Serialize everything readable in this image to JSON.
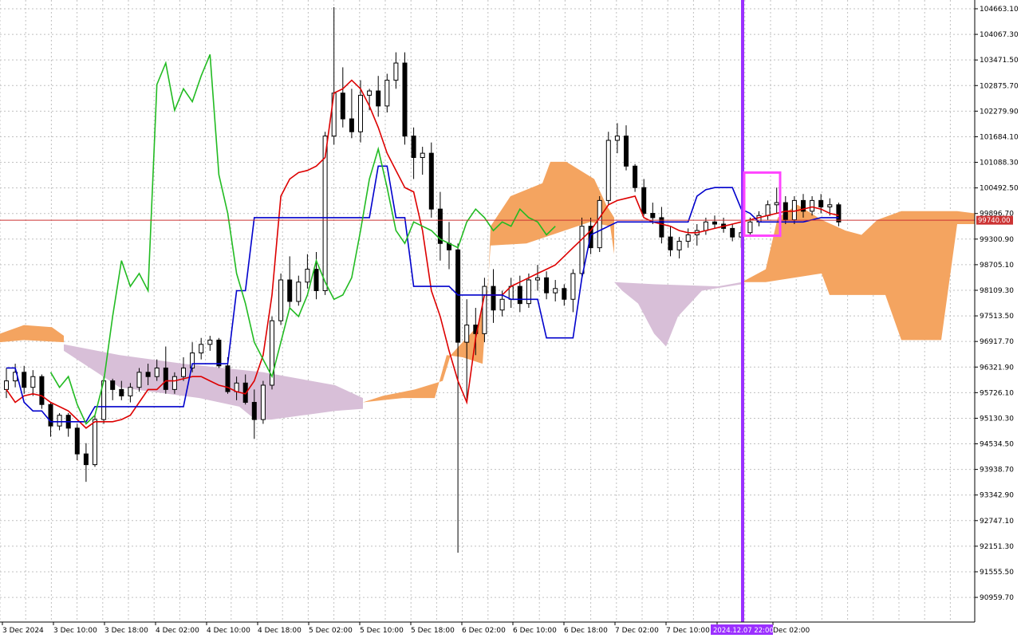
{
  "chart_data": {
    "type": "candlestick",
    "title": "",
    "xlabel": "",
    "ylabel": "",
    "ylim": [
      90600,
      104900
    ],
    "grid": true,
    "y_ticks": [
      104663.1,
      104067.3,
      103471.5,
      102875.7,
      102279.9,
      101684.1,
      101088.3,
      100492.5,
      99896.7,
      99300.9,
      98705.1,
      98109.3,
      97513.5,
      96917.7,
      96321.9,
      95726.1,
      95130.3,
      94534.5,
      93938.7,
      93342.9,
      92747.1,
      92151.3,
      91555.5,
      90959.7
    ],
    "x_ticks": [
      "3 Dec 2024",
      "3 Dec 10:00",
      "3 Dec 18:00",
      "4 Dec 02:00",
      "4 Dec 10:00",
      "4 Dec 18:00",
      "5 Dec 02:00",
      "5 Dec 10:00",
      "5 Dec 18:00",
      "6 Dec 02:00",
      "6 Dec 10:00",
      "6 Dec 18:00",
      "7 Dec 02:00",
      "7 Dec 10:00",
      "",
      "Dec 02:00"
    ],
    "current_price": 99740.0,
    "current_price_label": "99740.00",
    "cursor_label": "2024.12.07 22:00",
    "cursor_x": 2024.1207,
    "colors": {
      "tenkan": "#dd0000",
      "kijun": "#0000cc",
      "chikou": "#22bb22",
      "kumo_bull": "#f4a460",
      "kumo_bear": "#d8bfd8",
      "cursor": "#9b30ff",
      "highlight": "#ff44ff",
      "price_line": "#cc3333",
      "grid": "#c0c0c0"
    },
    "candles": [
      [
        95800,
        96300,
        95600,
        96000
      ],
      [
        96000,
        96400,
        95850,
        96200
      ],
      [
        96200,
        96350,
        95700,
        95850
      ],
      [
        95850,
        96250,
        95650,
        96100
      ],
      [
        96100,
        96150,
        95350,
        95450
      ],
      [
        95450,
        95500,
        94700,
        94950
      ],
      [
        94950,
        95250,
        94850,
        95200
      ],
      [
        95200,
        95250,
        94700,
        94900
      ],
      [
        94900,
        95000,
        94150,
        94300
      ],
      [
        94300,
        94550,
        93650,
        94050
      ],
      [
        94050,
        95200,
        94000,
        95100
      ],
      [
        95100,
        96100,
        95000,
        96000
      ],
      [
        96000,
        96050,
        95550,
        95800
      ],
      [
        95800,
        96000,
        95550,
        95650
      ],
      [
        95650,
        95950,
        95500,
        95850
      ],
      [
        95850,
        96300,
        95750,
        96200
      ],
      [
        96200,
        96400,
        95900,
        96100
      ],
      [
        96100,
        96500,
        96000,
        96300
      ],
      [
        96300,
        96800,
        95700,
        95800
      ],
      [
        95800,
        96200,
        95700,
        96100
      ],
      [
        96100,
        96550,
        96000,
        96300
      ],
      [
        96300,
        96900,
        96200,
        96650
      ],
      [
        96650,
        97000,
        96500,
        96850
      ],
      [
        96850,
        97050,
        96700,
        96950
      ],
      [
        96950,
        97000,
        96300,
        96350
      ],
      [
        96350,
        96550,
        95700,
        95750
      ],
      [
        95750,
        96100,
        95550,
        95950
      ],
      [
        95950,
        96150,
        95450,
        95500
      ],
      [
        95500,
        95800,
        94650,
        95100
      ],
      [
        95100,
        96000,
        95000,
        95900
      ],
      [
        95900,
        97500,
        95800,
        97400
      ],
      [
        97400,
        98500,
        97300,
        98350
      ],
      [
        98350,
        98900,
        97700,
        97850
      ],
      [
        97850,
        98450,
        97750,
        98300
      ],
      [
        98300,
        98950,
        98150,
        98600
      ],
      [
        98600,
        99000,
        97900,
        98100
      ],
      [
        98100,
        101800,
        98000,
        101700
      ],
      [
        101700,
        104700,
        101500,
        102700
      ],
      [
        102700,
        103300,
        101900,
        102100
      ],
      [
        102100,
        102800,
        101650,
        101800
      ],
      [
        101800,
        103000,
        101550,
        102650
      ],
      [
        102650,
        102800,
        102300,
        102750
      ],
      [
        102750,
        103100,
        102150,
        102400
      ],
      [
        102400,
        103150,
        102250,
        103000
      ],
      [
        103000,
        103650,
        102800,
        103400
      ],
      [
        103400,
        103650,
        101500,
        101700
      ],
      [
        101700,
        101900,
        100700,
        101200
      ],
      [
        101200,
        101450,
        100800,
        101300
      ],
      [
        101300,
        101550,
        99800,
        100000
      ],
      [
        100000,
        100400,
        98800,
        99200
      ],
      [
        99200,
        99700,
        98600,
        99050
      ],
      [
        99050,
        99200,
        92000,
        96900
      ],
      [
        96900,
        97900,
        95500,
        97300
      ],
      [
        97300,
        97700,
        96600,
        97100
      ],
      [
        97100,
        98400,
        96900,
        98200
      ],
      [
        98200,
        98600,
        97350,
        97650
      ],
      [
        97650,
        98100,
        97500,
        97900
      ],
      [
        97900,
        98400,
        97700,
        98200
      ],
      [
        98200,
        98450,
        97600,
        97800
      ],
      [
        97800,
        98500,
        97700,
        98350
      ],
      [
        98350,
        98700,
        98100,
        98400
      ],
      [
        98400,
        98550,
        97900,
        98050
      ],
      [
        98050,
        98350,
        97850,
        98150
      ],
      [
        98150,
        98250,
        97750,
        97900
      ],
      [
        97900,
        98600,
        97600,
        98500
      ],
      [
        98500,
        99800,
        98400,
        99600
      ],
      [
        99600,
        99800,
        98950,
        99100
      ],
      [
        99100,
        100300,
        99000,
        100200
      ],
      [
        100200,
        101800,
        100100,
        101600
      ],
      [
        101600,
        102000,
        101300,
        101700
      ],
      [
        101700,
        101950,
        100900,
        101000
      ],
      [
        101000,
        101050,
        100400,
        100500
      ],
      [
        100500,
        100700,
        99850,
        99900
      ],
      [
        99900,
        100150,
        99650,
        99800
      ],
      [
        99800,
        100050,
        99200,
        99350
      ],
      [
        99350,
        99600,
        98900,
        99050
      ],
      [
        99050,
        99350,
        98850,
        99250
      ],
      [
        99250,
        99550,
        99100,
        99400
      ],
      [
        99400,
        99650,
        99150,
        99500
      ],
      [
        99500,
        99800,
        99400,
        99700
      ],
      [
        99700,
        99850,
        99550,
        99650
      ],
      [
        99650,
        99800,
        99450,
        99550
      ],
      [
        99550,
        99650,
        99250,
        99350
      ],
      [
        99350,
        99600,
        99100,
        99450
      ],
      [
        99450,
        99800,
        99350,
        99700
      ],
      [
        99700,
        99950,
        99600,
        99850
      ],
      [
        99850,
        100200,
        99750,
        100100
      ],
      [
        100100,
        100500,
        99900,
        100150
      ],
      [
        100150,
        100300,
        99650,
        99750
      ],
      [
        99750,
        100300,
        99650,
        100200
      ],
      [
        100200,
        100350,
        99800,
        99950
      ],
      [
        99950,
        100300,
        99850,
        100200
      ],
      [
        100200,
        100350,
        99900,
        100050
      ],
      [
        100050,
        100250,
        99850,
        100100
      ],
      [
        100100,
        100150,
        99600,
        99700
      ]
    ],
    "series": [
      {
        "name": "",
        "color": "#dd0000",
        "values": [
          95800,
          95500,
          95650,
          95700,
          95650,
          95500,
          95400,
          95300,
          95100,
          94900,
          95050,
          95050,
          95050,
          95100,
          95200,
          95500,
          95800,
          95800,
          96000,
          96000,
          96050,
          96100,
          96100,
          96000,
          95900,
          95850,
          95750,
          95700,
          96000,
          96600,
          98000,
          100300,
          100700,
          100850,
          100900,
          101000,
          101200,
          102700,
          102800,
          103000,
          102800,
          102400,
          101900,
          101300,
          100900,
          100500,
          100400,
          99500,
          98100,
          97500,
          96700,
          96000,
          95500,
          97000,
          98000,
          98000,
          98000,
          98200,
          98300,
          98400,
          98500,
          98600,
          98700,
          98900,
          99100,
          99300,
          99500,
          99800,
          100100,
          100200,
          100250,
          100300,
          99800,
          99700,
          99650,
          99600,
          99500,
          99450,
          99450,
          99500,
          99550,
          99600,
          99650,
          99700,
          99750,
          99800,
          99850,
          99900,
          99950,
          99950,
          100000,
          100050,
          100000,
          99900,
          99850
        ]
      },
      {
        "name": "",
        "color": "#0000cc",
        "values": [
          96300,
          96300,
          95500,
          95300,
          95300,
          95050,
          95050,
          95050,
          95050,
          95050,
          95400,
          95400,
          95400,
          95400,
          95400,
          95400,
          95400,
          95400,
          95400,
          95400,
          95400,
          96400,
          96400,
          96400,
          96400,
          96400,
          98100,
          98100,
          99800,
          99800,
          99800,
          99800,
          99800,
          99800,
          99800,
          99800,
          99800,
          99800,
          99800,
          99800,
          99800,
          99800,
          101000,
          101000,
          99800,
          99800,
          98200,
          98200,
          98200,
          98200,
          98200,
          98000,
          98000,
          98000,
          98000,
          98000,
          98000,
          97900,
          97900,
          97900,
          97900,
          97000,
          97000,
          97000,
          97000,
          98400,
          99400,
          99500,
          99600,
          99700,
          99700,
          99700,
          99700,
          99700,
          99700,
          99700,
          99700,
          99700,
          100300,
          100450,
          100500,
          100500,
          100500,
          100000,
          99900,
          99700,
          99700,
          99700,
          99700,
          99700,
          99700,
          99750,
          99800,
          99800,
          99800
        ]
      },
      {
        "name": "",
        "color": "#22bb22",
        "values": [
          96200,
          95850,
          96100,
          95450,
          95000,
          95200,
          96000,
          97500,
          98800,
          98200,
          98500,
          98100,
          102900,
          103400,
          102300,
          102800,
          102500,
          103100,
          103600,
          100800,
          99900,
          98500,
          97800,
          96900,
          96500,
          96100,
          96900,
          97700,
          97500,
          98000,
          98800,
          98300,
          97900,
          98000,
          98400,
          99500,
          100700,
          101400,
          100500,
          99500,
          99200,
          99700,
          99600,
          99500,
          99300,
          99200,
          99100,
          99700,
          100000,
          99800,
          99500,
          99700,
          99600,
          100000,
          99800,
          99700,
          99400,
          99600
        ]
      }
    ]
  },
  "x_ticks_note": ""
}
